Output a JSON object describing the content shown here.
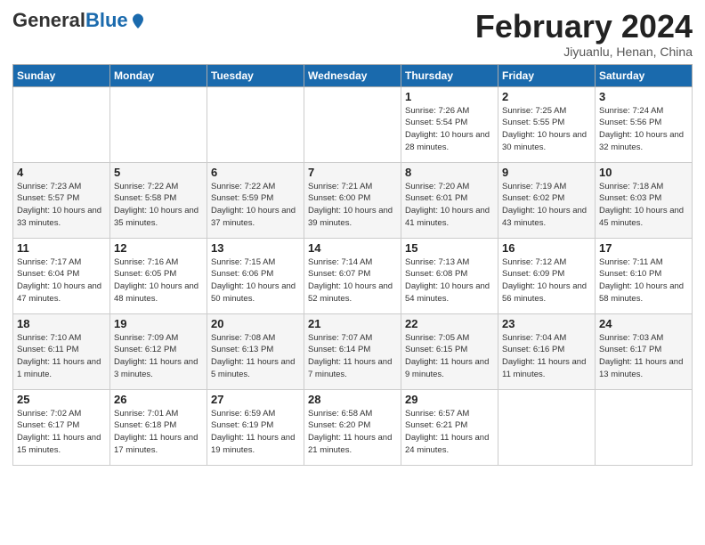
{
  "logo": {
    "text_general": "General",
    "text_blue": "Blue"
  },
  "header": {
    "title": "February 2024",
    "subtitle": "Jiyuanlu, Henan, China"
  },
  "days_of_week": [
    "Sunday",
    "Monday",
    "Tuesday",
    "Wednesday",
    "Thursday",
    "Friday",
    "Saturday"
  ],
  "weeks": [
    [
      {
        "day": "",
        "info": ""
      },
      {
        "day": "",
        "info": ""
      },
      {
        "day": "",
        "info": ""
      },
      {
        "day": "",
        "info": ""
      },
      {
        "day": "1",
        "info": "Sunrise: 7:26 AM\nSunset: 5:54 PM\nDaylight: 10 hours\nand 28 minutes."
      },
      {
        "day": "2",
        "info": "Sunrise: 7:25 AM\nSunset: 5:55 PM\nDaylight: 10 hours\nand 30 minutes."
      },
      {
        "day": "3",
        "info": "Sunrise: 7:24 AM\nSunset: 5:56 PM\nDaylight: 10 hours\nand 32 minutes."
      }
    ],
    [
      {
        "day": "4",
        "info": "Sunrise: 7:23 AM\nSunset: 5:57 PM\nDaylight: 10 hours\nand 33 minutes."
      },
      {
        "day": "5",
        "info": "Sunrise: 7:22 AM\nSunset: 5:58 PM\nDaylight: 10 hours\nand 35 minutes."
      },
      {
        "day": "6",
        "info": "Sunrise: 7:22 AM\nSunset: 5:59 PM\nDaylight: 10 hours\nand 37 minutes."
      },
      {
        "day": "7",
        "info": "Sunrise: 7:21 AM\nSunset: 6:00 PM\nDaylight: 10 hours\nand 39 minutes."
      },
      {
        "day": "8",
        "info": "Sunrise: 7:20 AM\nSunset: 6:01 PM\nDaylight: 10 hours\nand 41 minutes."
      },
      {
        "day": "9",
        "info": "Sunrise: 7:19 AM\nSunset: 6:02 PM\nDaylight: 10 hours\nand 43 minutes."
      },
      {
        "day": "10",
        "info": "Sunrise: 7:18 AM\nSunset: 6:03 PM\nDaylight: 10 hours\nand 45 minutes."
      }
    ],
    [
      {
        "day": "11",
        "info": "Sunrise: 7:17 AM\nSunset: 6:04 PM\nDaylight: 10 hours\nand 47 minutes."
      },
      {
        "day": "12",
        "info": "Sunrise: 7:16 AM\nSunset: 6:05 PM\nDaylight: 10 hours\nand 48 minutes."
      },
      {
        "day": "13",
        "info": "Sunrise: 7:15 AM\nSunset: 6:06 PM\nDaylight: 10 hours\nand 50 minutes."
      },
      {
        "day": "14",
        "info": "Sunrise: 7:14 AM\nSunset: 6:07 PM\nDaylight: 10 hours\nand 52 minutes."
      },
      {
        "day": "15",
        "info": "Sunrise: 7:13 AM\nSunset: 6:08 PM\nDaylight: 10 hours\nand 54 minutes."
      },
      {
        "day": "16",
        "info": "Sunrise: 7:12 AM\nSunset: 6:09 PM\nDaylight: 10 hours\nand 56 minutes."
      },
      {
        "day": "17",
        "info": "Sunrise: 7:11 AM\nSunset: 6:10 PM\nDaylight: 10 hours\nand 58 minutes."
      }
    ],
    [
      {
        "day": "18",
        "info": "Sunrise: 7:10 AM\nSunset: 6:11 PM\nDaylight: 11 hours\nand 1 minute."
      },
      {
        "day": "19",
        "info": "Sunrise: 7:09 AM\nSunset: 6:12 PM\nDaylight: 11 hours\nand 3 minutes."
      },
      {
        "day": "20",
        "info": "Sunrise: 7:08 AM\nSunset: 6:13 PM\nDaylight: 11 hours\nand 5 minutes."
      },
      {
        "day": "21",
        "info": "Sunrise: 7:07 AM\nSunset: 6:14 PM\nDaylight: 11 hours\nand 7 minutes."
      },
      {
        "day": "22",
        "info": "Sunrise: 7:05 AM\nSunset: 6:15 PM\nDaylight: 11 hours\nand 9 minutes."
      },
      {
        "day": "23",
        "info": "Sunrise: 7:04 AM\nSunset: 6:16 PM\nDaylight: 11 hours\nand 11 minutes."
      },
      {
        "day": "24",
        "info": "Sunrise: 7:03 AM\nSunset: 6:17 PM\nDaylight: 11 hours\nand 13 minutes."
      }
    ],
    [
      {
        "day": "25",
        "info": "Sunrise: 7:02 AM\nSunset: 6:17 PM\nDaylight: 11 hours\nand 15 minutes."
      },
      {
        "day": "26",
        "info": "Sunrise: 7:01 AM\nSunset: 6:18 PM\nDaylight: 11 hours\nand 17 minutes."
      },
      {
        "day": "27",
        "info": "Sunrise: 6:59 AM\nSunset: 6:19 PM\nDaylight: 11 hours\nand 19 minutes."
      },
      {
        "day": "28",
        "info": "Sunrise: 6:58 AM\nSunset: 6:20 PM\nDaylight: 11 hours\nand 21 minutes."
      },
      {
        "day": "29",
        "info": "Sunrise: 6:57 AM\nSunset: 6:21 PM\nDaylight: 11 hours\nand 24 minutes."
      },
      {
        "day": "",
        "info": ""
      },
      {
        "day": "",
        "info": ""
      }
    ]
  ]
}
